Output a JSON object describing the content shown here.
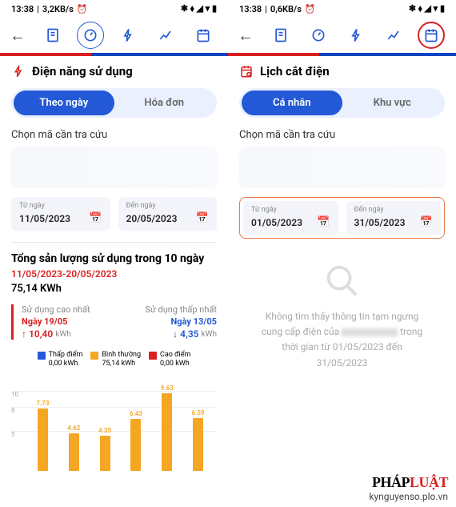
{
  "left": {
    "status": {
      "time": "13:38",
      "speed": "3,2KB/s",
      "icons": "⏰ ✱ ⬧ ▴ ▾ ▮"
    },
    "header_title": "Điện năng sử dụng",
    "seg": {
      "a": "Theo ngày",
      "b": "Hóa đơn"
    },
    "lookup_label": "Chọn mã cần tra cứu",
    "date_from": {
      "label": "Từ ngày",
      "value": "11/05/2023"
    },
    "date_to": {
      "label": "Đến ngày",
      "value": "20/05/2023"
    },
    "summary": {
      "title": "Tổng sản lượng sử dụng trong 10 ngày",
      "range": "11/05/2023-20/05/2023",
      "value": "75,14 KWh"
    },
    "high": {
      "label": "Sử dụng cao nhất",
      "date": "Ngày 19/05",
      "arrow": "↑",
      "value": "10,40",
      "unit": "kWh"
    },
    "low": {
      "label": "Sử dụng thấp nhất",
      "date": "Ngày 13/05",
      "arrow": "↓",
      "value": "4,35",
      "unit": "kWh"
    },
    "legend": {
      "low": {
        "name": "Thấp điểm",
        "value": "0,00 kWh"
      },
      "normal": {
        "name": "Bình thường",
        "value": "75,14 kWh"
      },
      "high": {
        "name": "Cao điểm",
        "value": "0,00 kWh"
      }
    }
  },
  "right": {
    "status": {
      "time": "13:38",
      "speed": "0,6KB/s",
      "icons": "⏰ ✱ ⬧ ▴ ▾ ▮"
    },
    "header_title": "Lịch cắt điện",
    "seg": {
      "a": "Cá nhân",
      "b": "Khu vực"
    },
    "lookup_label": "Chọn mã cần tra cứu",
    "date_from": {
      "label": "Từ ngày",
      "value": "01/05/2023"
    },
    "date_to": {
      "label": "Đến ngày",
      "value": "31/05/2023"
    },
    "empty_l1": "Không tìm thấy thông tin tạm ngưng cung cấp điện của ",
    "empty_l2": " trong thời gian từ 01/05/2023 đến 31/05/2023"
  },
  "chart_data": {
    "type": "bar",
    "y_ticks": [
      5,
      8,
      10
    ],
    "bars": [
      {
        "label": "7.73",
        "value": 7.73
      },
      {
        "label": "4.62",
        "value": 4.62
      },
      {
        "label": "4.35",
        "value": 4.35
      },
      {
        "label": "6.43",
        "value": 6.43
      },
      {
        "label": "9.63",
        "value": 9.63
      },
      {
        "label": "6.59",
        "value": 6.59
      }
    ],
    "color": "#f5a623",
    "ymax": 12
  },
  "watermark": {
    "brand_a": "PHÁP",
    "brand_b": "LUẬT",
    "url": "kynguyenso.plo.vn"
  }
}
